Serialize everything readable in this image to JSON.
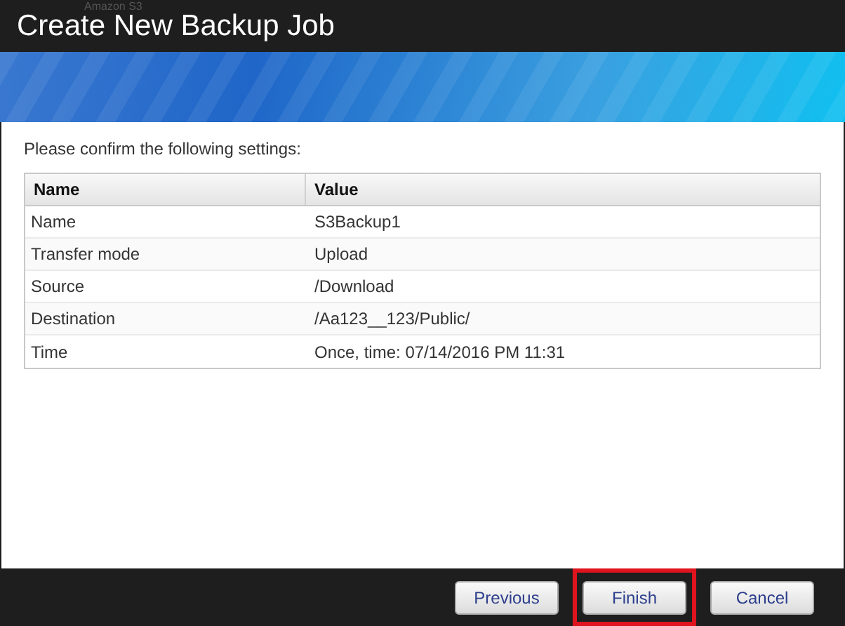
{
  "background_text": "Amazon S3",
  "dialog": {
    "title": "Create New Backup Job"
  },
  "prompt": "Please confirm the following settings:",
  "table": {
    "columns": [
      "Name",
      "Value"
    ],
    "rows": [
      [
        "Name",
        "S3Backup1"
      ],
      [
        "Transfer mode",
        "Upload"
      ],
      [
        "Source",
        "/Download"
      ],
      [
        "Destination",
        "/Aa123__123/Public/"
      ],
      [
        "Time",
        "Once, time: 07/14/2016 PM 11:31"
      ]
    ]
  },
  "buttons": [
    {
      "label": "Previous",
      "highlighted": false
    },
    {
      "label": "Finish",
      "highlighted": true
    },
    {
      "label": "Cancel",
      "highlighted": false
    }
  ]
}
